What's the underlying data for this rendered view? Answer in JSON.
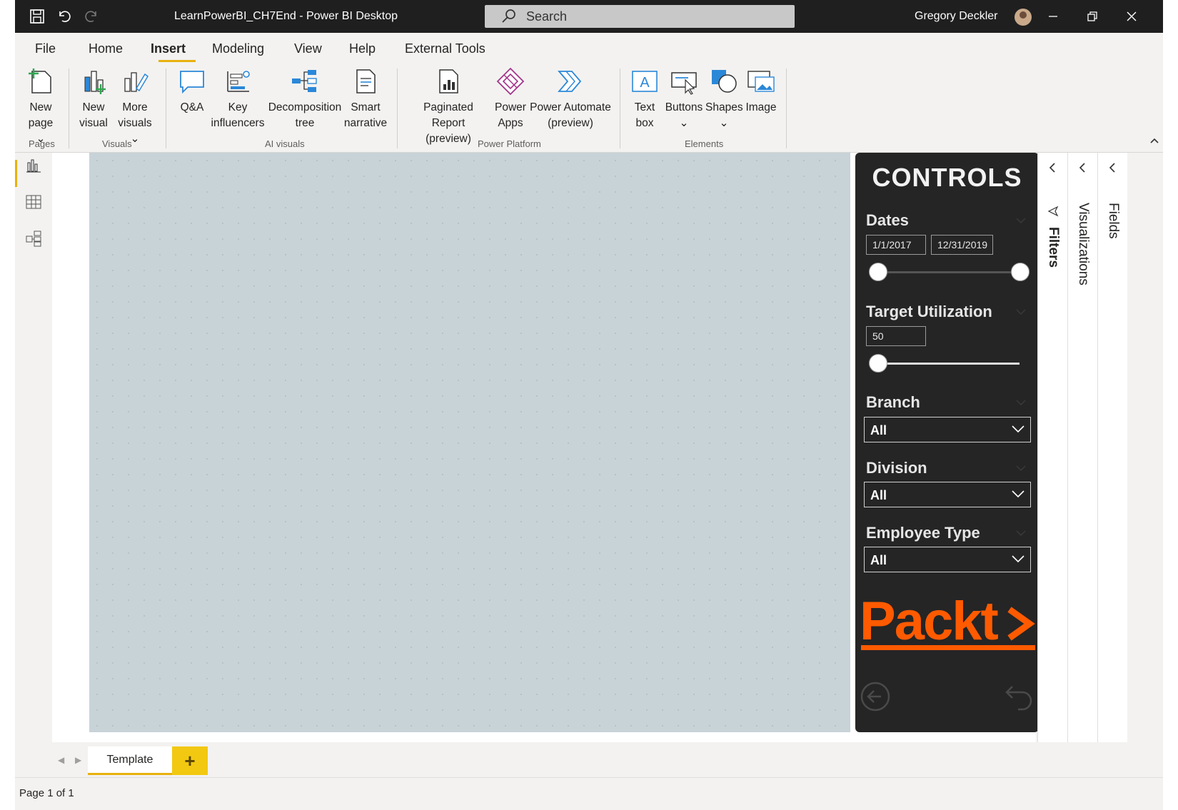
{
  "titlebar": {
    "title": "LearnPowerBI_CH7End - Power BI Desktop",
    "search_placeholder": "Search",
    "user_name": "Gregory Deckler",
    "icons": [
      "save-icon",
      "undo-icon",
      "redo-icon",
      "search-icon",
      "minimize-icon",
      "restore-icon",
      "close-icon"
    ]
  },
  "menu": {
    "items": [
      {
        "label": "File"
      },
      {
        "label": "Home"
      },
      {
        "label": "Insert",
        "active": true
      },
      {
        "label": "Modeling"
      },
      {
        "label": "View"
      },
      {
        "label": "Help"
      },
      {
        "label": "External Tools"
      }
    ]
  },
  "ribbon": {
    "groups": {
      "pages": "Pages",
      "visuals": "Visuals",
      "ai_visuals": "AI visuals",
      "power_platform": "Power Platform",
      "elements": "Elements"
    },
    "buttons": {
      "new_page": [
        "New",
        "page ⌄"
      ],
      "new_visual": [
        "New",
        "visual"
      ],
      "more_visuals": [
        "More",
        "visuals ⌄"
      ],
      "qa": [
        "Q&A"
      ],
      "key_influencers": [
        "Key",
        "influencers"
      ],
      "decomposition_tree": [
        "Decomposition",
        "tree"
      ],
      "smart_narrative": [
        "Smart",
        "narrative"
      ],
      "paginated_report": [
        "Paginated Report",
        "(preview)"
      ],
      "power_apps": [
        "Power",
        "Apps"
      ],
      "power_automate": [
        "Power Automate",
        "(preview)"
      ],
      "text_box": [
        "Text",
        "box"
      ],
      "buttons": [
        "Buttons",
        "⌄"
      ],
      "shapes": [
        "Shapes",
        "⌄"
      ],
      "image": [
        "Image"
      ]
    }
  },
  "controls": {
    "title": "CONTROLS",
    "dates": {
      "label": "Dates",
      "start": "1/1/2017",
      "end": "12/31/2019"
    },
    "target_utilization": {
      "label": "Target Utilization",
      "value": "50"
    },
    "branch": {
      "label": "Branch",
      "value": "All"
    },
    "division": {
      "label": "Division",
      "value": "All"
    },
    "employee_type": {
      "label": "Employee Type",
      "value": "All"
    },
    "logo_text": "Packt>"
  },
  "panes": {
    "filters": "Filters",
    "visualizations": "Visualizations",
    "fields": "Fields"
  },
  "tabs": {
    "page_tab": "Template",
    "add_label": "+"
  },
  "status": {
    "page_indicator": "Page 1 of 1"
  },
  "colors": {
    "accent": "#e8b10e",
    "canvas": "#c8d3d8",
    "controls_bg": "#252525",
    "packt_orange": "#ff5a00",
    "ribbon_blue": "#2b88d8"
  }
}
